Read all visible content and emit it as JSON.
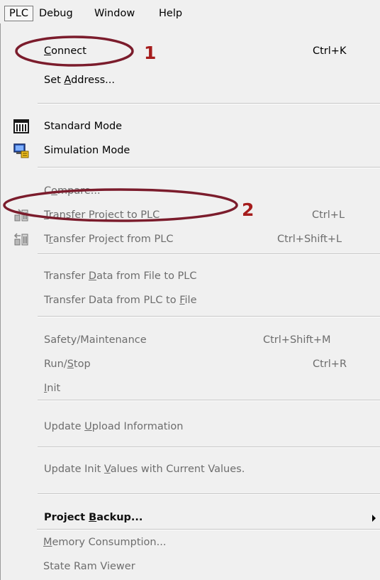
{
  "menubar": {
    "items": [
      "PLC",
      "Debug",
      "Window",
      "Help"
    ]
  },
  "menu": {
    "connect": {
      "pre": "",
      "u": "C",
      "post": "onnect",
      "shortcut": "Ctrl+K"
    },
    "set_address": {
      "pre": "Set ",
      "u": "A",
      "post": "ddress..."
    },
    "standard_mode": {
      "label": "Standard Mode"
    },
    "simulation_mode": {
      "label": "Simulation Mode"
    },
    "compare": {
      "pre": "C",
      "u": "o",
      "post": "mpare..."
    },
    "transfer_to": {
      "pre": "",
      "u": "T",
      "post": "ransfer Project to PLC",
      "shortcut": "Ctrl+L"
    },
    "transfer_from": {
      "pre": "T",
      "u": "r",
      "post": "ansfer Project from PLC",
      "shortcut": "Ctrl+Shift+L"
    },
    "data_file_to_plc": {
      "pre": "Transfer ",
      "u": "D",
      "post": "ata from File to PLC"
    },
    "data_plc_to_file": {
      "pre": "Transfer Data from PLC to ",
      "u": "F",
      "post": "ile"
    },
    "safety": {
      "label": "Safety/Maintenance",
      "shortcut": "Ctrl+Shift+M"
    },
    "run_stop": {
      "pre": "Run/",
      "u": "S",
      "post": "top",
      "shortcut": "Ctrl+R"
    },
    "init": {
      "pre": "",
      "u": "I",
      "post": "nit"
    },
    "update_upload": {
      "pre": "Update ",
      "u": "U",
      "post": "pload Information"
    },
    "update_init": {
      "pre": "Update Init ",
      "u": "V",
      "post": "alues with Current Values."
    },
    "project_backup": {
      "pre": "Project ",
      "u": "B",
      "post": "ackup..."
    },
    "memory": {
      "pre": "",
      "u": "M",
      "post": "emory Consumption..."
    },
    "state_ram": {
      "label": "State Ram Viewer"
    }
  },
  "annotations": {
    "marker1": "1",
    "marker2": "2",
    "color": "#7b1c2c"
  }
}
